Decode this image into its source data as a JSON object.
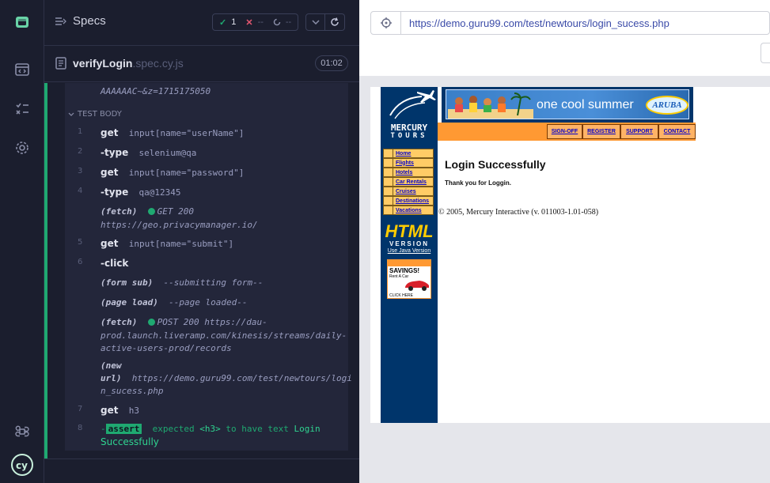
{
  "reporter": {
    "specs_label": "Specs",
    "stats": {
      "passed": "1",
      "failed": "--",
      "pending": "--"
    },
    "spec": {
      "name": "verifyLogin",
      "ext": ".spec.cy.js",
      "duration": "01:02"
    },
    "test_body_label": "TEST BODY",
    "top_truncated": "AAAAAAC~&z=1715175050",
    "commands": [
      {
        "num": "1",
        "name": "get",
        "message": "input[name=\"userName\"]"
      },
      {
        "num": "2",
        "name": "-type",
        "message": "selenium@qa"
      },
      {
        "num": "3",
        "name": "get",
        "message": "input[name=\"password\"]"
      },
      {
        "num": "4",
        "name": "-type",
        "message": "qa@12345"
      },
      {
        "num": "",
        "name": "(fetch)",
        "status": "GET 200",
        "message": "https://geo.privacymanager.io/"
      },
      {
        "num": "5",
        "name": "get",
        "message": "input[name=\"submit\"]"
      },
      {
        "num": "6",
        "name": "-click",
        "message": ""
      },
      {
        "num": "",
        "name": "(form sub)",
        "message": "--submitting form--"
      },
      {
        "num": "",
        "name": "(page load)",
        "message": "--page loaded--"
      },
      {
        "num": "",
        "name": "(fetch)",
        "status": "POST 200",
        "message_l1": "https://dau-",
        "message_l2": "prod.launch.liveramp.com/kinesis/streams/daily-",
        "message_l3": "active-users-prod/records"
      },
      {
        "num": "",
        "name_l1": "(new",
        "name_l2": "url)",
        "message_l1": "https://demo.guru99.com/test/newtours/logi",
        "message_l2": "n_sucess.php"
      },
      {
        "num": "7",
        "name": "get",
        "message": "h3"
      },
      {
        "num": "8",
        "name": "assert",
        "expected": "expected",
        "tag": "<h3>",
        "to_have": "to have text",
        "value_l1": "Login",
        "value_l2": "Successfully"
      }
    ]
  },
  "aut": {
    "url": "https://demo.guru99.com/test/newtours/login_sucess.php",
    "logo_l1": "MERCURY",
    "logo_l2": "TOURS",
    "banner_text": "one cool summer",
    "banner_brand": "ARUBA",
    "top_nav": [
      "SIGN-OFF",
      "REGISTER",
      "SUPPORT",
      "CONTACT"
    ],
    "side_nav": [
      "Home",
      "Flights",
      "Hotels",
      "Car Rentals",
      "Cruises",
      "Destinations",
      "Vacations"
    ],
    "html_version_l1": "HTML",
    "html_version_l2": "VERSION",
    "use_java": "Use Java Version",
    "savings_l1": "SAVINGS!",
    "savings_l2": "Rent A Car",
    "savings_l3": "CLICK HERE",
    "title": "Login Successfully",
    "subtitle": "Thank you for Loggin.",
    "copyright": "© 2005, Mercury Interactive (v. 011003-1.01-058)"
  },
  "colors": {
    "pass_green": "#1fa971",
    "fail_red": "#e45770",
    "sidebar_bg": "#1b1e2e",
    "mercury_blue": "#00356b",
    "mercury_orange": "#ff9933"
  }
}
